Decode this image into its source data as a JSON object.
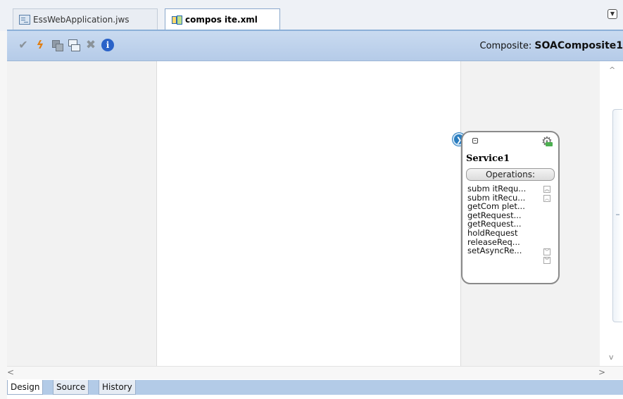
{
  "tabs": [
    {
      "label": "EssWebApplication.jws",
      "icon": "workspace-icon",
      "active": false
    },
    {
      "label": "compos ite.xml",
      "icon": "composite-icon",
      "active": true
    }
  ],
  "toolbar": {
    "icons": [
      "validate-check-icon",
      "deploy-bolt-icon",
      "copy-icon",
      "layout-icon",
      "delete-icon",
      "info-icon"
    ],
    "composite_prefix": "Composite:",
    "composite_name": "SOAComposite1"
  },
  "service": {
    "name": "Service1",
    "operations_header": "Operations:",
    "operations": [
      "subm itRequ...",
      "subm itRecu...",
      "getCom plet...",
      "getRequest...",
      "getRequest...",
      "holdRequest",
      "releaseReq...",
      "setAsyncRe..."
    ]
  },
  "bottom_tabs": [
    {
      "label": "Design",
      "active": true
    },
    {
      "label": "Source",
      "active": false
    },
    {
      "label": "History",
      "active": false
    }
  ],
  "colors": {
    "toolbar_bg": "#c1d4ee",
    "swimlane_bg": "#f2f2f2",
    "port_blue": "#2a7dbf",
    "bottom_bar": "#b3cbe7"
  }
}
